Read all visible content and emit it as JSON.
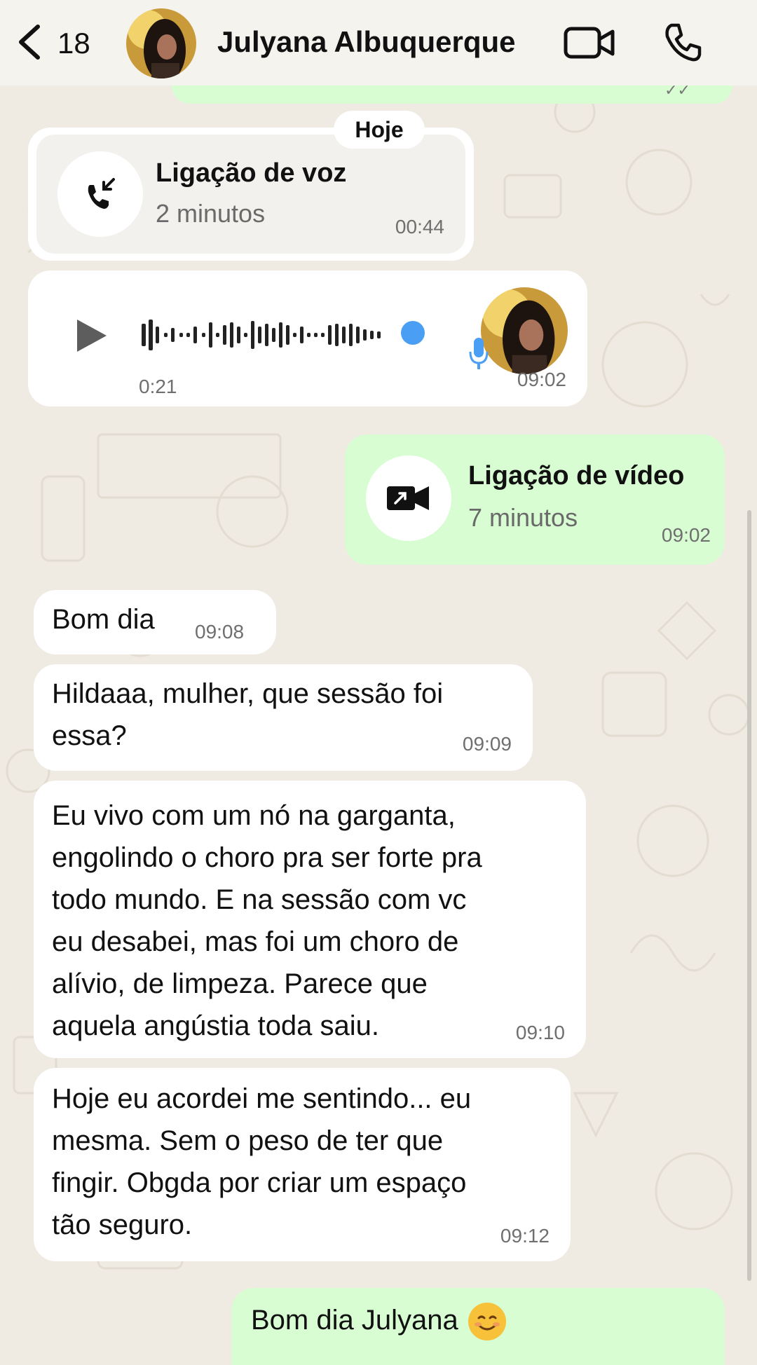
{
  "header": {
    "back_count": "18",
    "contact_name": "Julyana Albuquerque"
  },
  "date_pill": "Hoje",
  "messages": {
    "voice_call": {
      "title": "Ligação de voz",
      "duration": "2 minutos",
      "time": "00:44"
    },
    "audio": {
      "duration": "0:21",
      "time": "09:02",
      "progress": 1.0
    },
    "video_call": {
      "title": "Ligação de vídeo",
      "duration": "7 minutos",
      "time": "09:02"
    },
    "msg1": {
      "text": "Bom dia",
      "time": "09:08"
    },
    "msg2": {
      "line1": "Hildaaa, mulher, que sessão foi",
      "line2": "essa?",
      "time": "09:09"
    },
    "msg3": {
      "line1": "Eu vivo com um nó na garganta,",
      "line2": "engolindo o choro pra ser forte pra",
      "line3": "todo mundo. E na sessão com vc",
      "line4": "eu desabei, mas foi um choro de",
      "line5": "alívio, de limpeza. Parece que",
      "line6": "aquela angústia toda saiu.",
      "time": "09:10"
    },
    "msg4": {
      "line1": "Hoje eu acordei me sentindo... eu",
      "line2": "mesma. Sem o peso de ter que",
      "line3": "fingir. Obgda por criar um espaço",
      "line4": "tão seguro.",
      "time": "09:12"
    },
    "msg5": {
      "text": "Bom dia Julyana",
      "emoji": "smiling-face-emoji"
    }
  },
  "colors": {
    "incoming_bubble": "#ffffff",
    "outgoing_bubble": "#d8fdd2",
    "chat_background": "#efeae2",
    "audio_dot": "#4a9ff5"
  },
  "icons": [
    "back-chevron-icon",
    "video-camera-icon",
    "phone-icon",
    "incoming-call-icon",
    "play-icon",
    "microphone-icon",
    "video-call-icon"
  ]
}
